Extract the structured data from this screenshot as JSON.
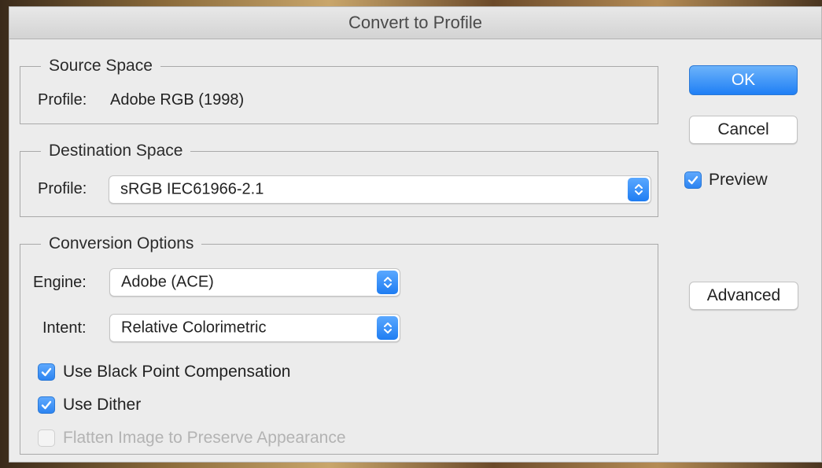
{
  "dialog": {
    "title": "Convert to Profile",
    "accent_color": "#1f7ff5"
  },
  "source_space": {
    "legend": "Source Space",
    "profile_label": "Profile:",
    "profile_value": "Adobe RGB (1998)"
  },
  "destination_space": {
    "legend": "Destination Space",
    "profile_label": "Profile:",
    "profile_selected": "sRGB IEC61966-2.1"
  },
  "conversion_options": {
    "legend": "Conversion Options",
    "engine_label": "Engine:",
    "engine_selected": "Adobe (ACE)",
    "intent_label": "Intent:",
    "intent_selected": "Relative Colorimetric",
    "black_point": {
      "label": "Use Black Point Compensation",
      "checked": true
    },
    "dither": {
      "label": "Use Dither",
      "checked": true
    },
    "flatten": {
      "label": "Flatten Image to Preserve Appearance",
      "checked": false,
      "disabled": true
    }
  },
  "buttons": {
    "ok": "OK",
    "cancel": "Cancel",
    "advanced": "Advanced"
  },
  "preview": {
    "label": "Preview",
    "checked": true
  }
}
